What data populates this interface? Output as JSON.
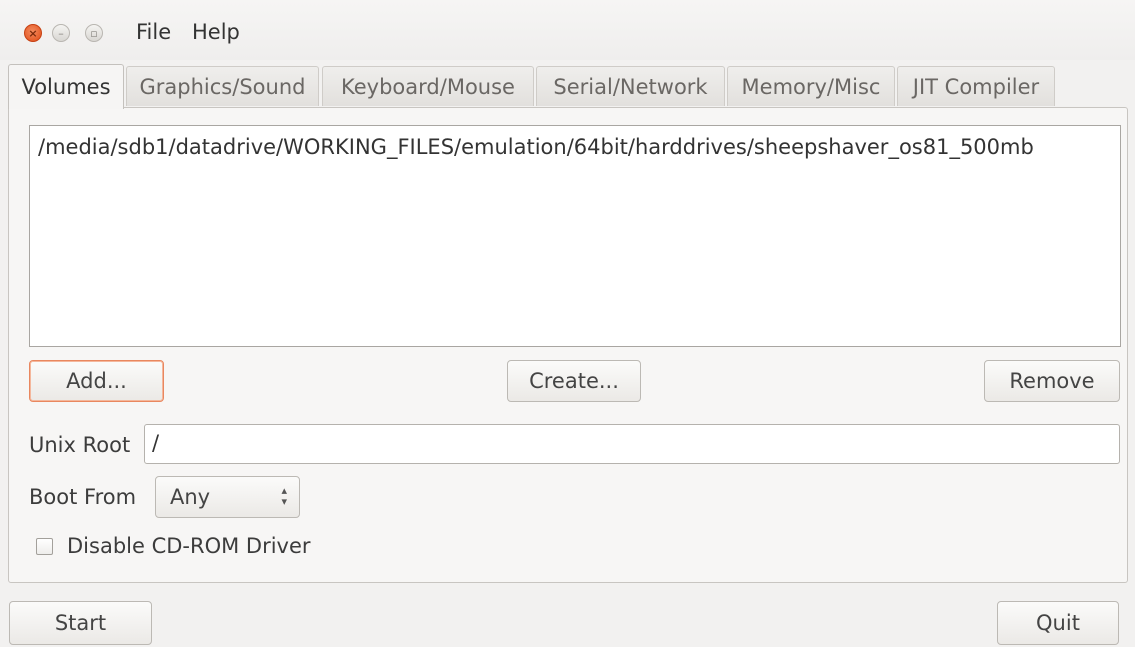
{
  "menu": {
    "file": "File",
    "help": "Help"
  },
  "window_controls": {
    "close_glyph": "×",
    "minimize_glyph": "–",
    "maximize_glyph": "▫"
  },
  "tabs": [
    {
      "label": "Volumes",
      "active": true
    },
    {
      "label": "Graphics/Sound",
      "active": false
    },
    {
      "label": "Keyboard/Mouse",
      "active": false
    },
    {
      "label": "Serial/Network",
      "active": false
    },
    {
      "label": "Memory/Misc",
      "active": false
    },
    {
      "label": "JIT Compiler",
      "active": false
    }
  ],
  "volumes": {
    "items": [
      "/media/sdb1/datadrive/WORKING_FILES/emulation/64bit/harddrives/sheepshaver_os81_500mb"
    ],
    "add_label": "Add...",
    "create_label": "Create...",
    "remove_label": "Remove",
    "unix_root_label": "Unix Root",
    "unix_root_value": "/",
    "boot_from_label": "Boot From",
    "boot_from_value": "Any",
    "disable_cdrom_label": "Disable CD-ROM Driver",
    "disable_cdrom_checked": false
  },
  "footer": {
    "start_label": "Start",
    "quit_label": "Quit"
  },
  "colors": {
    "window_bg": "#f2f1f0",
    "close_button": "#df4b16",
    "focus_ring": "#e9875f"
  }
}
